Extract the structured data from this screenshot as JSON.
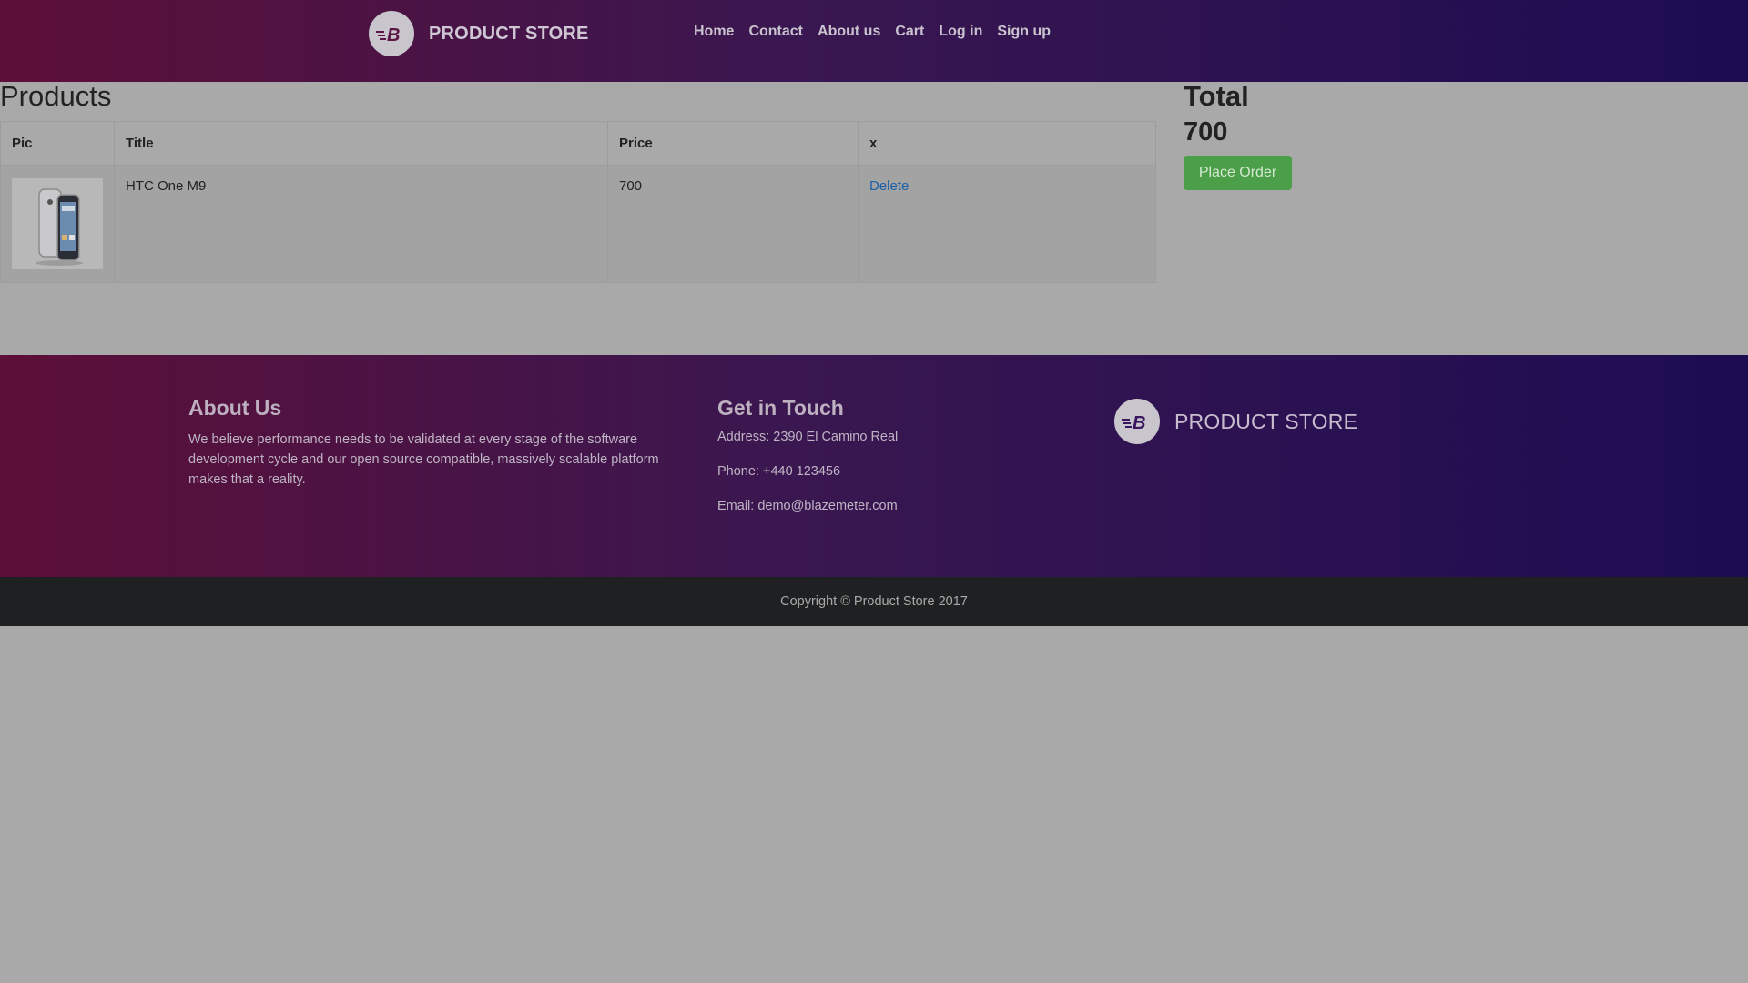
{
  "navbar": {
    "brand": "PRODUCT STORE",
    "links": [
      "Home",
      "Contact",
      "About us",
      "Cart",
      "Log in",
      "Sign up"
    ]
  },
  "products": {
    "heading": "Products",
    "columns": [
      "Pic",
      "Title",
      "Price",
      "x"
    ],
    "rows": [
      {
        "image": "phone-image",
        "title": "HTC One M9",
        "price": "700",
        "action": "Delete"
      }
    ]
  },
  "total": {
    "heading": "Total",
    "value": "700",
    "button": "Place Order"
  },
  "footer": {
    "about_title": "About Us",
    "about_text": "We believe performance needs to be validated at every stage of the software development cycle and our open source compatible, massively scalable platform makes that a reality.",
    "touch_title": "Get in Touch",
    "address": "Address: 2390 El Camino Real",
    "phone": "Phone: +440 123456",
    "email": "Email: demo@blazemeter.com",
    "brand": "PRODUCT STORE"
  },
  "copyright": "Copyright © Product Store 2017",
  "colors": {
    "header_gradient_start": "#5c0f38",
    "header_gradient_end": "#1d0c52",
    "place_order": "#4b9f48",
    "link": "#1b5fa8",
    "copyright_bar": "#1f2021"
  }
}
